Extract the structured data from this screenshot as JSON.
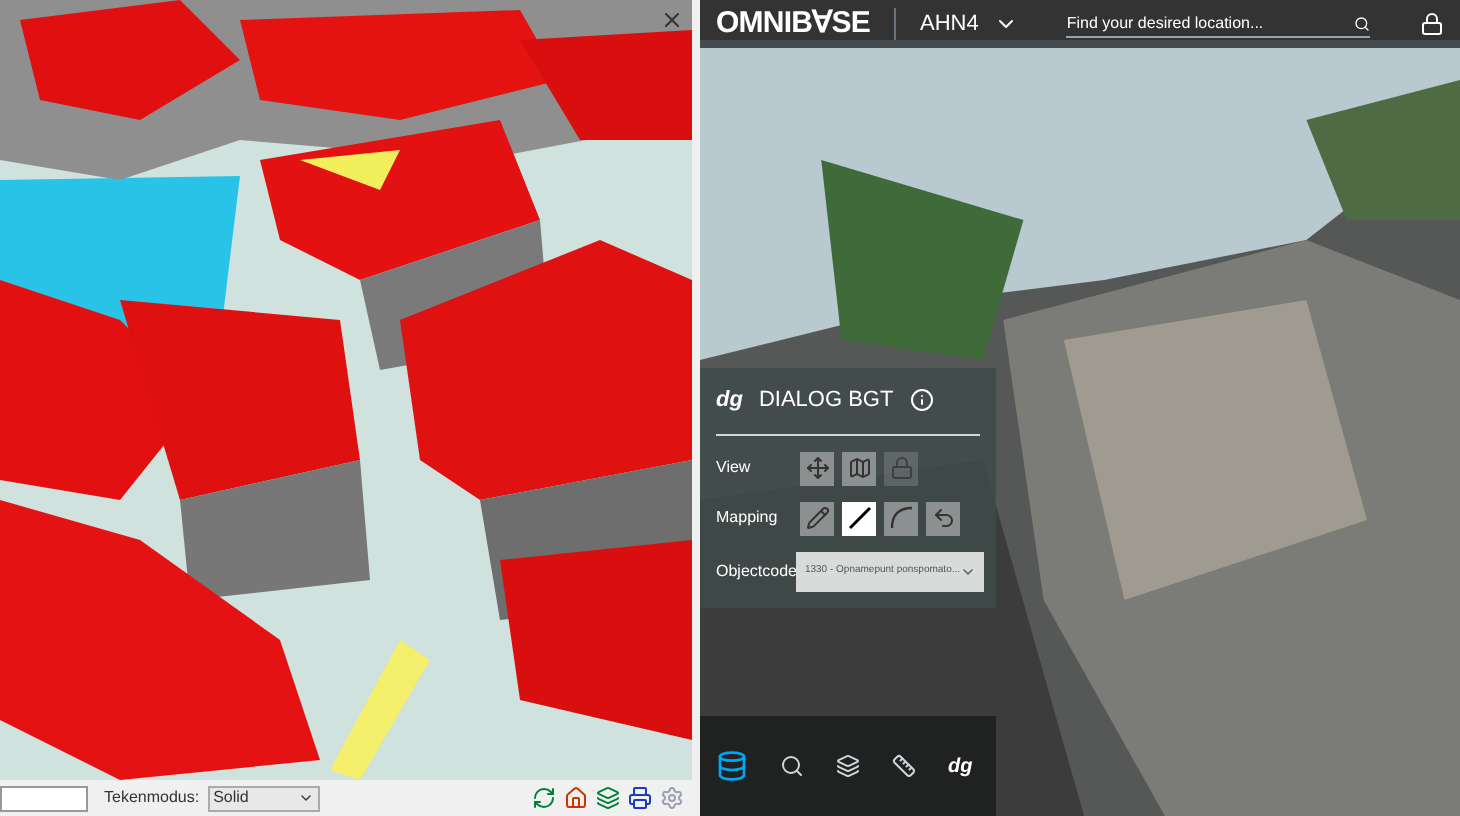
{
  "left_view": {
    "toolbar": {
      "tekenmodus_label": "Tekenmodus:",
      "tekenmodus_value": "Solid"
    }
  },
  "right_view": {
    "header": {
      "logo": "OMNIB∀SE",
      "dataset": "AHN4",
      "search": {
        "placeholder": "Find your desired location..."
      }
    },
    "dialog": {
      "logo": "dg",
      "title": "DIALOG BGT",
      "rows": [
        {
          "label": "View",
          "tools": [
            {
              "kind": "move",
              "selected": false,
              "disabled": false
            },
            {
              "kind": "plane",
              "selected": false,
              "disabled": false
            },
            {
              "kind": "camera",
              "selected": false,
              "disabled": true
            }
          ]
        },
        {
          "label": "Mapping",
          "tools": [
            {
              "kind": "pencil",
              "selected": false,
              "disabled": false
            },
            {
              "kind": "line",
              "selected": true,
              "disabled": false
            },
            {
              "kind": "arc",
              "selected": false,
              "disabled": false
            },
            {
              "kind": "undo",
              "selected": false,
              "disabled": false
            }
          ]
        }
      ],
      "objectcode_label": "Objectcode",
      "objectcode_value": "1330 - Opnamepunt ponspomato..."
    },
    "bottom_nav": {
      "logo": "dg"
    }
  }
}
